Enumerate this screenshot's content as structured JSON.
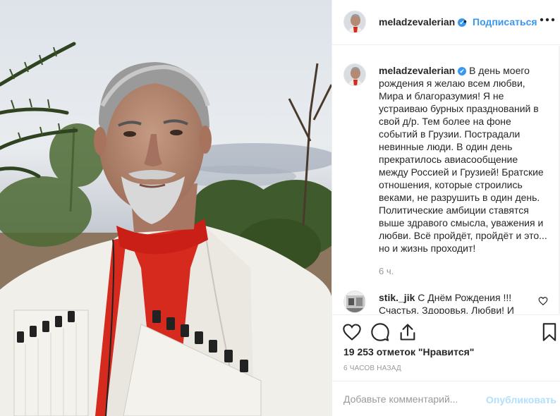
{
  "post": {
    "username": "meladzevalerian",
    "verified_mark": "✔",
    "follow_label": "Подписаться",
    "separator": "•",
    "more_label": "•••"
  },
  "caption": {
    "username": "meladzevalerian",
    "text": "В день моего рождения я желаю всем любви, Мира и благоразумия! Я не устраиваю бурных празднований в свой д/р. Тем более на фоне событий в Грузии. Пострадали невинные люди. В один день прекратилось авиасообщение между Россией и Грузией! Братские отношения, которые строились веками, не разрушить в один день. Политические амбиции ставятся выше здравого смысла, уважения и любви. Всё пройдёт, пройдёт и это... но и жизнь проходит!",
    "time": "6 ч."
  },
  "comment": {
    "username": "stik._jik",
    "text": "С Днём Рождения !!! Счастья, Здоровья, Любви! И"
  },
  "stats": {
    "likes": "19 253 отметок \"Нравится\"",
    "posted": "6 ЧАСОВ НАЗАД"
  },
  "composer": {
    "placeholder": "Добавьте комментарий...",
    "publish_label": "Опубликовать"
  },
  "icons": {
    "like": "heart-icon",
    "comment": "comment-icon",
    "share": "share-icon",
    "save": "bookmark-icon",
    "more": "more-options-icon"
  },
  "colors": {
    "accent": "#3897f0",
    "publish_disabled": "#b2dffc",
    "text": "#262626",
    "muted": "#999999",
    "shirt_red": "#d62a1e"
  }
}
